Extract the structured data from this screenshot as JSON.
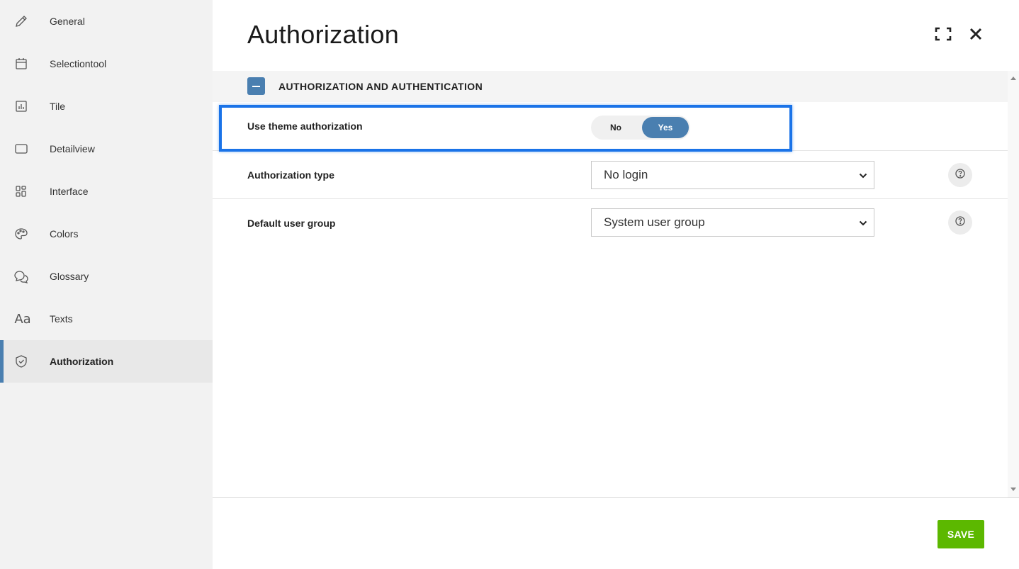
{
  "sidebar": {
    "items": [
      {
        "label": "General",
        "icon": "pencil-icon",
        "active": false
      },
      {
        "label": "Selectiontool",
        "icon": "calendar-icon",
        "active": false
      },
      {
        "label": "Tile",
        "icon": "bar-chart-icon",
        "active": false
      },
      {
        "label": "Detailview",
        "icon": "rectangle-icon",
        "active": false
      },
      {
        "label": "Interface",
        "icon": "grid-icon",
        "active": false
      },
      {
        "label": "Colors",
        "icon": "palette-icon",
        "active": false
      },
      {
        "label": "Glossary",
        "icon": "chat-bubbles-icon",
        "active": false
      },
      {
        "label": "Texts",
        "icon": "text-aa-icon",
        "active": false
      },
      {
        "label": "Authorization",
        "icon": "shield-check-icon",
        "active": true
      }
    ],
    "texts_icon_glyph": "Aa"
  },
  "header": {
    "title": "Authorization",
    "fullscreen_icon": "fullscreen-icon",
    "close_icon": "close-icon"
  },
  "section": {
    "title": "AUTHORIZATION AND AUTHENTICATION",
    "collapse_icon": "minus-icon"
  },
  "fields": {
    "use_theme_authorization": {
      "label": "Use theme authorization",
      "options": [
        "No",
        "Yes"
      ],
      "selected": "Yes"
    },
    "authorization_type": {
      "label": "Authorization type",
      "value": "No login"
    },
    "default_user_group": {
      "label": "Default user group",
      "value": "System user group"
    }
  },
  "footer": {
    "save_label": "SAVE"
  },
  "colors": {
    "accent": "#4a7fb0",
    "highlight_border": "#1a73e8",
    "save_button": "#5cb800",
    "sidebar_bg": "#f2f2f2"
  }
}
